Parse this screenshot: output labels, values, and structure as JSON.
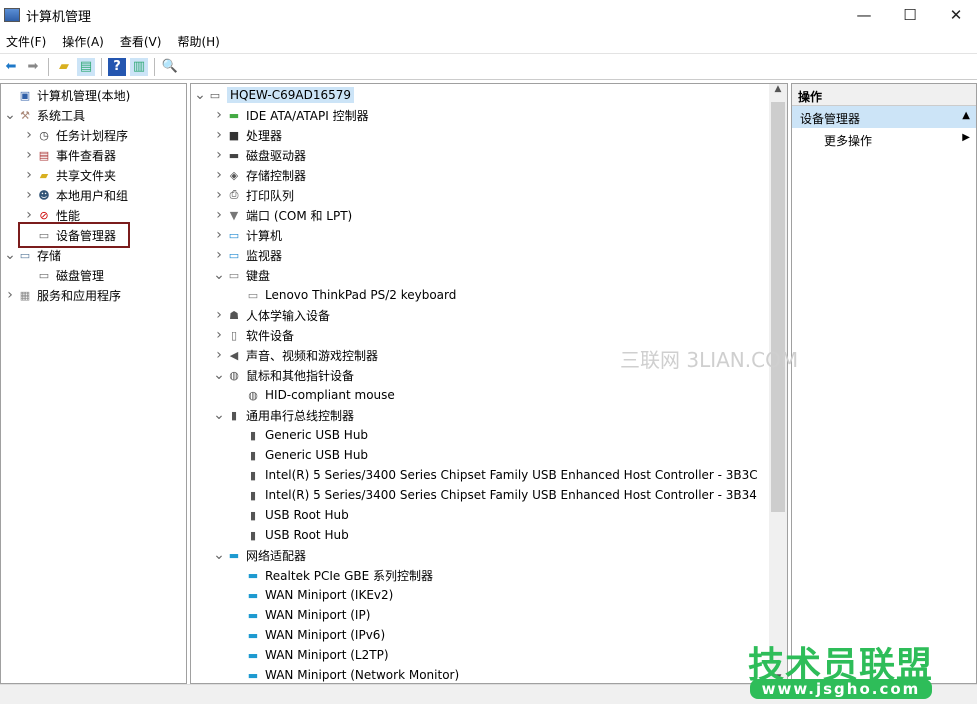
{
  "window": {
    "title": "计算机管理",
    "minimize": "—",
    "maximize": "☐",
    "close": "✕"
  },
  "menu": [
    "文件(F)",
    "操作(A)",
    "查看(V)",
    "帮助(H)"
  ],
  "toolbar": {
    "icons": [
      "back-arrow-icon",
      "forward-arrow-icon",
      "up-folder-icon",
      "show-hide-console-tree-icon",
      "help-icon",
      "show-hide-action-pane-icon",
      "properties-icon"
    ]
  },
  "left_tree": [
    {
      "label": "计算机管理(本地)",
      "level": 0,
      "arrow": "",
      "icon": "computer-management-icon"
    },
    {
      "label": "系统工具",
      "level": 0,
      "arrow": "v",
      "icon": "tools-icon"
    },
    {
      "label": "任务计划程序",
      "level": 1,
      "arrow": ">",
      "icon": "clock-icon"
    },
    {
      "label": "事件查看器",
      "level": 1,
      "arrow": ">",
      "icon": "event-viewer-icon"
    },
    {
      "label": "共享文件夹",
      "level": 1,
      "arrow": ">",
      "icon": "shared-folder-icon"
    },
    {
      "label": "本地用户和组",
      "level": 1,
      "arrow": ">",
      "icon": "users-icon"
    },
    {
      "label": "性能",
      "level": 1,
      "arrow": ">",
      "icon": "performance-icon"
    },
    {
      "label": "设备管理器",
      "level": 1,
      "arrow": "",
      "icon": "device-manager-icon",
      "selected": true
    },
    {
      "label": "存储",
      "level": 0,
      "arrow": "v",
      "icon": "storage-icon"
    },
    {
      "label": "磁盘管理",
      "level": 1,
      "arrow": "",
      "icon": "disk-management-icon"
    },
    {
      "label": "服务和应用程序",
      "level": 0,
      "arrow": ">",
      "icon": "services-icon"
    }
  ],
  "device_tree": [
    {
      "label": "HQEW-C69AD16579",
      "level": 0,
      "arrow": "v",
      "icon": "computer-icon"
    },
    {
      "label": "IDE ATA/ATAPI 控制器",
      "level": 1,
      "arrow": ">",
      "icon": "ide-icon"
    },
    {
      "label": "处理器",
      "level": 1,
      "arrow": ">",
      "icon": "processor-icon"
    },
    {
      "label": "磁盘驱动器",
      "level": 1,
      "arrow": ">",
      "icon": "disk-drive-icon"
    },
    {
      "label": "存储控制器",
      "level": 1,
      "arrow": ">",
      "icon": "storage-controller-icon"
    },
    {
      "label": "打印队列",
      "level": 1,
      "arrow": ">",
      "icon": "printer-icon"
    },
    {
      "label": "端口 (COM 和 LPT)",
      "level": 1,
      "arrow": ">",
      "icon": "port-icon"
    },
    {
      "label": "计算机",
      "level": 1,
      "arrow": ">",
      "icon": "monitor-icon"
    },
    {
      "label": "监视器",
      "level": 1,
      "arrow": ">",
      "icon": "monitor-icon"
    },
    {
      "label": "键盘",
      "level": 1,
      "arrow": "v",
      "icon": "keyboard-icon"
    },
    {
      "label": "Lenovo ThinkPad PS/2 keyboard",
      "level": 2,
      "arrow": "",
      "icon": "keyboard-icon"
    },
    {
      "label": "人体学输入设备",
      "level": 1,
      "arrow": ">",
      "icon": "hid-icon"
    },
    {
      "label": "软件设备",
      "level": 1,
      "arrow": ">",
      "icon": "software-device-icon"
    },
    {
      "label": "声音、视频和游戏控制器",
      "level": 1,
      "arrow": ">",
      "icon": "speaker-icon"
    },
    {
      "label": "鼠标和其他指针设备",
      "level": 1,
      "arrow": "v",
      "icon": "mouse-icon"
    },
    {
      "label": "HID-compliant mouse",
      "level": 2,
      "arrow": "",
      "icon": "mouse-icon"
    },
    {
      "label": "通用串行总线控制器",
      "level": 1,
      "arrow": "v",
      "icon": "usb-icon"
    },
    {
      "label": "Generic USB Hub",
      "level": 2,
      "arrow": "",
      "icon": "usb-icon"
    },
    {
      "label": "Generic USB Hub",
      "level": 2,
      "arrow": "",
      "icon": "usb-icon"
    },
    {
      "label": "Intel(R) 5 Series/3400 Series Chipset Family USB Enhanced Host Controller - 3B3C",
      "level": 2,
      "arrow": "",
      "icon": "usb-icon"
    },
    {
      "label": "Intel(R) 5 Series/3400 Series Chipset Family USB Enhanced Host Controller - 3B34",
      "level": 2,
      "arrow": "",
      "icon": "usb-icon"
    },
    {
      "label": "USB Root Hub",
      "level": 2,
      "arrow": "",
      "icon": "usb-icon"
    },
    {
      "label": "USB Root Hub",
      "level": 2,
      "arrow": "",
      "icon": "usb-icon"
    },
    {
      "label": "网络适配器",
      "level": 1,
      "arrow": "v",
      "icon": "network-icon"
    },
    {
      "label": "Realtek PCIe GBE 系列控制器",
      "level": 2,
      "arrow": "",
      "icon": "network-icon"
    },
    {
      "label": "WAN Miniport (IKEv2)",
      "level": 2,
      "arrow": "",
      "icon": "network-icon"
    },
    {
      "label": "WAN Miniport (IP)",
      "level": 2,
      "arrow": "",
      "icon": "network-icon"
    },
    {
      "label": "WAN Miniport (IPv6)",
      "level": 2,
      "arrow": "",
      "icon": "network-icon"
    },
    {
      "label": "WAN Miniport (L2TP)",
      "level": 2,
      "arrow": "",
      "icon": "network-icon"
    },
    {
      "label": "WAN Miniport (Network Monitor)",
      "level": 2,
      "arrow": "",
      "icon": "network-icon"
    }
  ],
  "actions": {
    "header": "操作",
    "section": "设备管理器",
    "more": "更多操作"
  },
  "watermarks": {
    "sanlian": "三联网 3LIAN.COM",
    "jsgho": "技术员联盟",
    "jsgho_url": "www.jsgho.com"
  }
}
